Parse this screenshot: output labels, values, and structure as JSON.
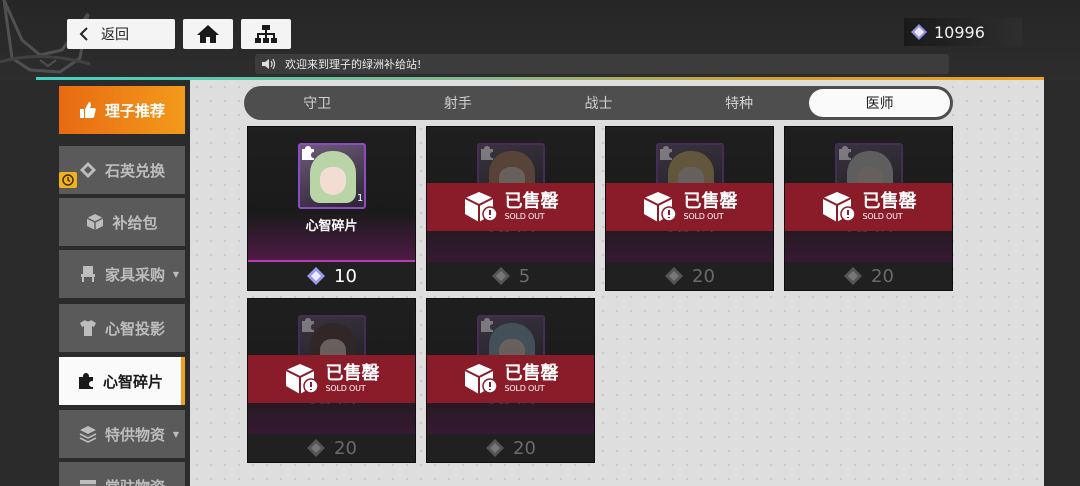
{
  "header": {
    "back_label": "返回",
    "currency_value": "10996",
    "notice": "欢迎来到理子的绿洲补给站!"
  },
  "colors": {
    "accent_orange": "#f0a020",
    "sold_banner": "#8a1c2a",
    "portrait_border": "#8e4bc2"
  },
  "sidebar": {
    "items": [
      {
        "label": "理子推荐",
        "icon": "thumbs-up-icon"
      },
      {
        "label": "石英兑换",
        "icon": "quartz-icon"
      },
      {
        "label": "补给包",
        "icon": "box-icon"
      },
      {
        "label": "家具采购",
        "icon": "chair-icon"
      },
      {
        "label": "心智投影",
        "icon": "shirt-icon"
      },
      {
        "label": "心智碎片",
        "icon": "puzzle-icon"
      },
      {
        "label": "特供物资",
        "icon": "layers-icon"
      },
      {
        "label": "常驻物资",
        "icon": "crate-icon"
      }
    ]
  },
  "tabs": [
    "守卫",
    "射手",
    "战士",
    "特种",
    "医师"
  ],
  "active_tab": "医师",
  "cards": [
    {
      "name": "心智碎片",
      "qty": "1",
      "price": "10",
      "sold_out": false
    },
    {
      "name": "心智碎片",
      "price": "5",
      "sold_out": true
    },
    {
      "name": "心智碎片",
      "price": "20",
      "sold_out": true
    },
    {
      "name": "心智碎片",
      "price": "20",
      "sold_out": true
    },
    {
      "name": "心智碎片",
      "price": "20",
      "sold_out": true
    },
    {
      "name": "心智碎片",
      "price": "20",
      "sold_out": true
    }
  ],
  "sold_out_text": {
    "cn": "已售罄",
    "en": "SOLD OUT"
  }
}
